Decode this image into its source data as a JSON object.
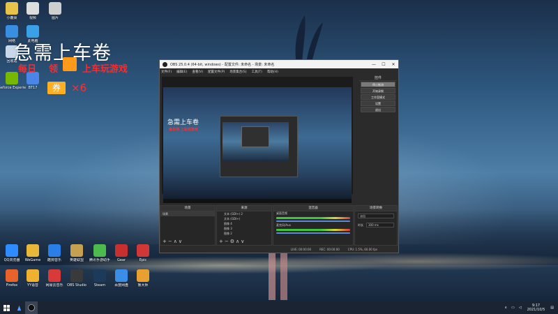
{
  "desktop": {
    "top_icons": [
      {
        "label": "小鹿桌",
        "color": "#e8c34a"
      },
      {
        "label": "视频",
        "color": "#dddddd"
      },
      {
        "label": "图片",
        "color": "#cfcfcf"
      },
      {
        "label": "网络",
        "color": "#3a8ee0"
      },
      {
        "label": "此电脑",
        "color": "#3aa0e8"
      },
      {
        "label": "回收站",
        "color": "#c8d8e8"
      },
      {
        "label": "Geforce Experience",
        "color": "#76b900"
      },
      {
        "label": "BT17",
        "color": "#4a86e8"
      }
    ],
    "bottom_icons_row1": [
      {
        "label": "QQ浏览器",
        "color": "#2f8cff"
      },
      {
        "label": "WeGame",
        "color": "#e8b838"
      },
      {
        "label": "酷狗音乐",
        "color": "#2a7ee8"
      },
      {
        "label": "英雄联盟",
        "color": "#c4a050"
      },
      {
        "label": "腾讯手游助手",
        "color": "#4cba4c"
      },
      {
        "label": "Gear",
        "color": "#c83030"
      },
      {
        "label": "Epic",
        "color": "#d03838"
      }
    ],
    "bottom_icons_row2": [
      {
        "label": "Firefox",
        "color": "#e8632a"
      },
      {
        "label": "YY语音",
        "color": "#f0b030"
      },
      {
        "label": "网易云音乐",
        "color": "#d83a3a"
      },
      {
        "label": "OBS Studio",
        "color": "#3a3a3a"
      },
      {
        "label": "Steam",
        "color": "#1c3a5a"
      },
      {
        "label": "百度网盘",
        "color": "#3a8ee8"
      },
      {
        "label": "鲁大师",
        "color": "#e8a030"
      }
    ]
  },
  "promo": {
    "title": "急需上车卷",
    "left_text": "每日",
    "mid_text": "领",
    "right_text": "上车玩游戏",
    "coupon": "券",
    "multiplier": "×6"
  },
  "obs": {
    "title": "OBS 25.0.4 (64-bit, windows) - 配置文件: 未命名 - 场景: 未命名",
    "menu": [
      "文件(F)",
      "编辑(E)",
      "查看(V)",
      "配置文件(P)",
      "场景集合(S)",
      "工具(T)",
      "帮助(H)"
    ],
    "controls": {
      "header": "控件",
      "buttons": [
        "停止推流",
        "开始录制",
        "工作室模式",
        "设置",
        "退出"
      ]
    },
    "scenes": {
      "header": "场景",
      "items": [
        "场景"
      ]
    },
    "sources": {
      "header": "来源",
      "items": [
        "文本 (GDI+) 2",
        "文本 (GDI+)",
        "图像 4",
        "图像 3",
        "图像 2"
      ]
    },
    "mixer": {
      "header": "混音器",
      "tracks": [
        "桌面音频",
        "麦克风/Aux"
      ]
    },
    "transitions": {
      "header": "场景转换",
      "type": "淡出",
      "duration_label": "时长",
      "duration": "300 ms"
    },
    "status": {
      "live": "LIVE: 00:00:00",
      "rec": "REC: 00:00:00",
      "cpu": "CPU: 1.5%, 60.00 fps"
    },
    "preview": {
      "title": "急需上车卷",
      "red": "每日领 上车玩游戏"
    }
  },
  "taskbar": {
    "time": "9:17",
    "date": "2021/10/5"
  }
}
